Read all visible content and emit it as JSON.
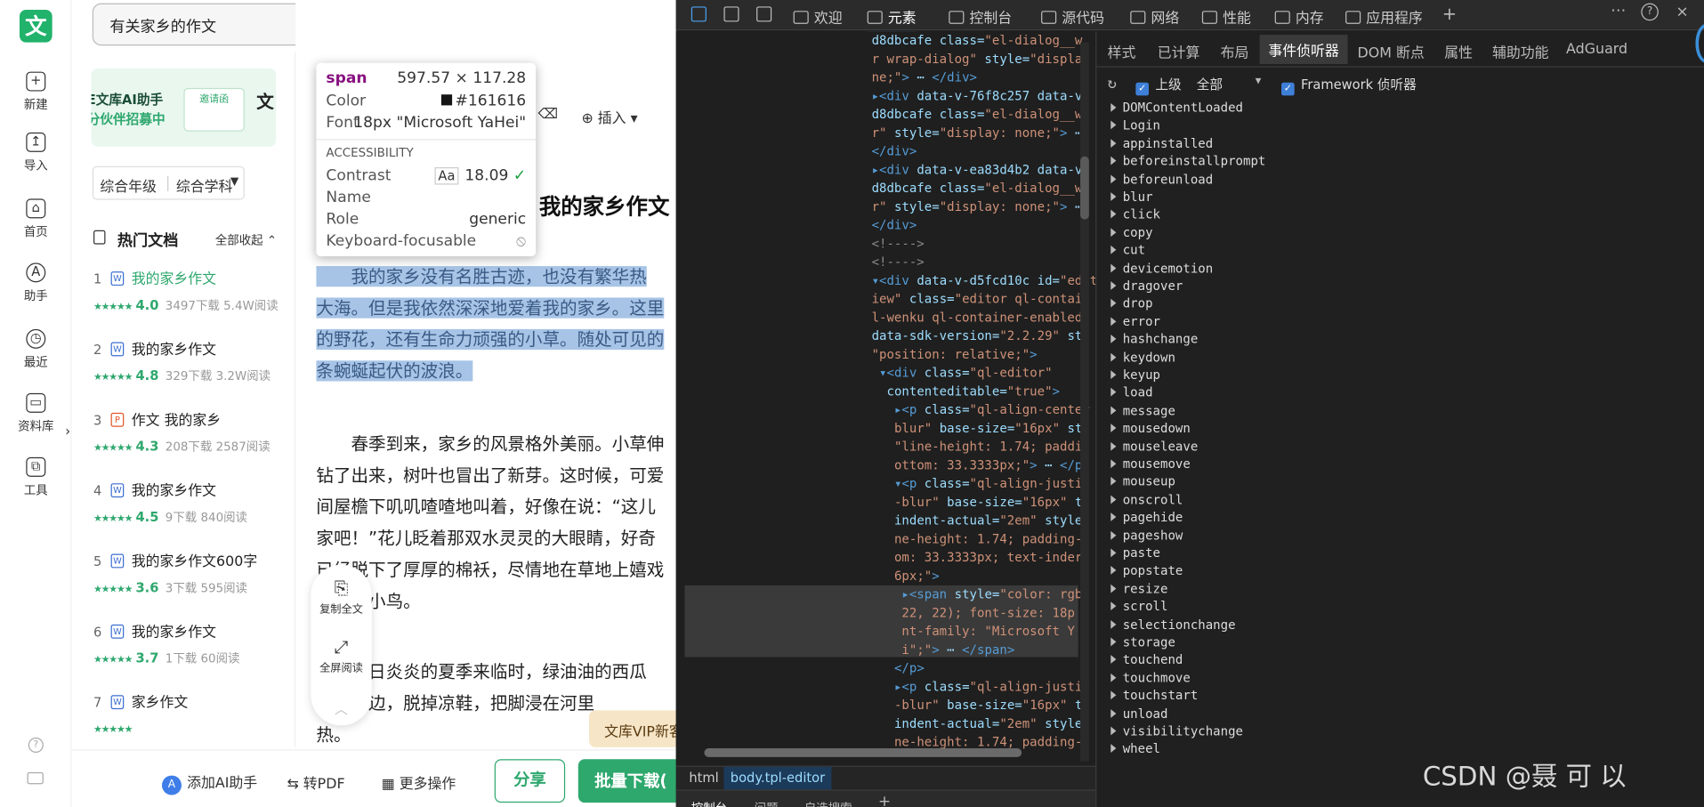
{
  "search": {
    "value": "有关家乡的作文"
  },
  "rail": {
    "logo": "文",
    "items": [
      "新建",
      "导入",
      "首页",
      "助手",
      "最近",
      "资料库",
      "工具"
    ]
  },
  "banner": {
    "line1": "E文库AI助手",
    "line2": "分伙伴招募中",
    "stamp": "邀请函",
    "right_text": "文"
  },
  "filter": {
    "grade": "综合年级",
    "subject": "综合学科"
  },
  "hot": {
    "title": "热门文档",
    "collapse": "全部收起"
  },
  "docs": [
    {
      "num": "1",
      "icon": "W",
      "title": "我的家乡作文",
      "score": "4.0",
      "downloads": "3497下载",
      "reads": "5.4W阅读",
      "active": true
    },
    {
      "num": "2",
      "icon": "W",
      "title": "我的家乡作文",
      "score": "4.8",
      "downloads": "329下载",
      "reads": "3.2W阅读"
    },
    {
      "num": "3",
      "icon": "P",
      "title": "作文 我的家乡",
      "score": "4.3",
      "downloads": "208下载",
      "reads": "2587阅读"
    },
    {
      "num": "4",
      "icon": "W",
      "title": "我的家乡作文",
      "score": "4.5",
      "downloads": "9下载",
      "reads": "840阅读"
    },
    {
      "num": "5",
      "icon": "W",
      "title": "我的家乡作文600字",
      "score": "3.6",
      "downloads": "3下载",
      "reads": "595阅读"
    },
    {
      "num": "6",
      "icon": "W",
      "title": "我的家乡作文",
      "score": "3.7",
      "downloads": "1下载",
      "reads": "60阅读"
    },
    {
      "num": "7",
      "icon": "W",
      "title": "家乡作文",
      "score": "",
      "downloads": "",
      "reads": ""
    }
  ],
  "toolbar": {
    "insert": "插入"
  },
  "doc_title": "我的家乡作文",
  "paragraphs": [
    "　　我的家乡没有名胜古迹，也没有繁华热",
    "大海。但是我依然深深地爱着我的家乡。这里",
    "的野花，还有生命力顽强的小草。随处可见的",
    "条蜿蜒起伏的波浪。",
    "　　春季到来，家乡的风景格外美丽。小草伸",
    "钻了出来，树叶也冒出了新芽。这时候，可爱",
    "间屋檐下叽叽喳喳地叫着，好像在说：“这儿",
    "家吧！”花儿眨着那双水灵灵的大眼睛，好奇",
    "已经脱下了厚厚的棉袄，尽情地在草地上嬉戏",
    "自在的小鸟。",
    "　　烈日炎炎的夏季来临时，绿油油的西瓜",
    "到小溪边，脱掉凉鞋，把脚浸在河里",
    "热。"
  ],
  "float_tools": {
    "copy": "复制全文",
    "fullscreen": "全屏阅读"
  },
  "vip": "文库VIP新客",
  "bottom": {
    "ai": "添加AI助手",
    "pdf": "转PDF",
    "more": "更多操作",
    "share": "分享",
    "batch": "批量下载("
  },
  "tooltip": {
    "tag": "span",
    "size": "597.57 × 117.28",
    "color_label": "Color",
    "color": "#161616",
    "font_label": "Font",
    "font": "18px \"Microsoft YaHei\"",
    "section": "ACCESSIBILITY",
    "contrast_label": "Contrast",
    "contrast": "18.09",
    "name_label": "Name",
    "role_label": "Role",
    "role": "generic",
    "kf_label": "Keyboard-focusable"
  },
  "devtools": {
    "tabs": [
      "欢迎",
      "元素",
      "控制台",
      "源代码",
      "网络",
      "性能",
      "内存",
      "应用程序"
    ],
    "right_tabs": [
      "样式",
      "已计算",
      "布局",
      "事件侦听器",
      "DOM 断点",
      "属性",
      "辅助功能",
      "AdGuard"
    ],
    "ancestors": "上级",
    "all": "全部",
    "framework": "Framework 侦听器",
    "events": [
      "DOMContentLoaded",
      "Login",
      "appinstalled",
      "beforeinstallprompt",
      "beforeunload",
      "blur",
      "click",
      "copy",
      "cut",
      "devicemotion",
      "dragover",
      "drop",
      "error",
      "hashchange",
      "keydown",
      "keyup",
      "load",
      "message",
      "mousedown",
      "mouseleave",
      "mousemove",
      "mouseup",
      "onscroll",
      "pagehide",
      "pageshow",
      "paste",
      "popstate",
      "resize",
      "scroll",
      "selectionchange",
      "storage",
      "touchend",
      "touchmove",
      "touchstart",
      "unload",
      "visibilitychange",
      "wheel"
    ],
    "breadcrumb": [
      "html",
      "body.tpl-editor"
    ],
    "bottom_tabs": [
      "控制台",
      "问题",
      "自选搜索"
    ],
    "watermark": "CSDN @聂 可 以"
  }
}
